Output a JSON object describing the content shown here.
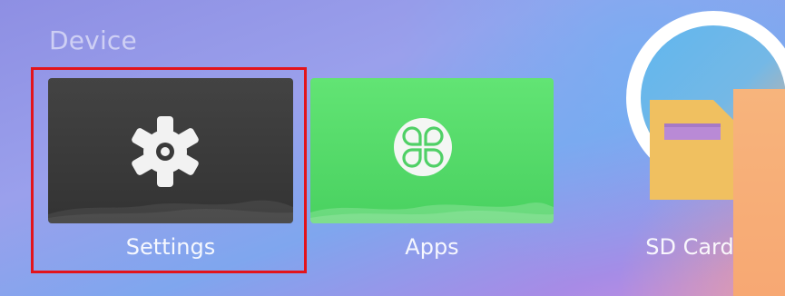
{
  "section": {
    "title": "Device"
  },
  "tiles": [
    {
      "label": "Settings",
      "icon": "gear-icon",
      "color": "#3b3b3b",
      "focused": true
    },
    {
      "label": "Apps",
      "icon": "apps-icon",
      "color": "#55d96a",
      "focused": false
    },
    {
      "label": "SD Card",
      "icon": "sd-card-icon",
      "color": "#f0c060",
      "focused": false
    }
  ],
  "colors": {
    "focus_frame": "#e3141b",
    "settings_tile": "#3b3b3b",
    "apps_tile": "#55d96a",
    "sd_card": "#f0c060"
  }
}
